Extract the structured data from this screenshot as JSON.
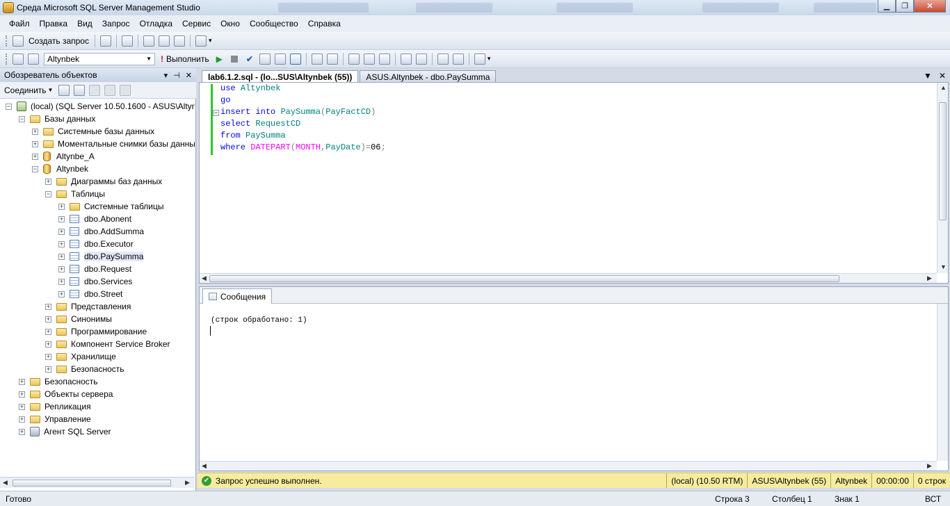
{
  "window": {
    "title": "Среда Microsoft SQL Server Management Studio",
    "min_label": "▁",
    "max_label": "❐",
    "close_label": "✕"
  },
  "menu": [
    "Файл",
    "Правка",
    "Вид",
    "Запрос",
    "Отладка",
    "Сервис",
    "Окно",
    "Сообщество",
    "Справка"
  ],
  "toolbar1": {
    "new_query_label": "Создать запрос"
  },
  "toolbar2": {
    "database_value": "Altynbek",
    "execute_label": "Выполнить"
  },
  "object_explorer": {
    "title": "Обозреватель объектов",
    "connect_label": "Соединить",
    "tree": {
      "server": "(local) (SQL Server 10.50.1600 - ASUS\\Altynb",
      "databases": "Базы данных",
      "system_databases": "Системные базы данных",
      "snapshots": "Моментальные снимки базы данны",
      "db_altynbe_a": "Altynbe_A",
      "db_altynbek": "Altynbek",
      "diagrams": "Диаграммы баз данных",
      "tables": "Таблицы",
      "system_tables": "Системные таблицы",
      "table_items": [
        "dbo.Abonent",
        "dbo.AddSumma",
        "dbo.Executor",
        "dbo.PaySumma",
        "dbo.Request",
        "dbo.Services",
        "dbo.Street"
      ],
      "views": "Представления",
      "synonyms": "Синонимы",
      "programmability": "Программирование",
      "service_broker": "Компонент Service Broker",
      "storage": "Хранилище",
      "db_security": "Безопасность",
      "security": "Безопасность",
      "server_objects": "Объекты сервера",
      "replication": "Репликация",
      "management": "Управление",
      "agent": "Агент SQL Server"
    }
  },
  "tabs": [
    {
      "label": "lab6.1.2.sql - (lo...SUS\\Altynbek (55))"
    },
    {
      "label": "ASUS.Altynbek - dbo.PaySumma"
    }
  ],
  "code": {
    "line1": {
      "kw": "use",
      "obj": "Altynbek"
    },
    "line2": {
      "kw": "go"
    },
    "line3": {
      "kw1": "insert",
      "kw2": "into",
      "obj": "PaySumma",
      "open": "(",
      "col": "PayFactCD",
      "close": ")"
    },
    "line4": {
      "kw": "select",
      "obj": "RequestCD"
    },
    "line5": {
      "kw": "from",
      "obj": "PaySumma"
    },
    "line6": {
      "kw": "where",
      "fn1": "DATEPART",
      "open": "(",
      "fn2": "MONTH",
      "comma": ",",
      "obj": "PayDate",
      "close": ")",
      "eq": "=",
      "val": "06",
      "semi": ";"
    }
  },
  "results": {
    "tab_label": "Сообщения",
    "message": "(строк обработано: 1)"
  },
  "query_status": {
    "message": "Запрос успешно выполнен.",
    "server": "(local) (10.50 RTM)",
    "login": "ASUS\\Altynbek (55)",
    "database": "Altynbek",
    "elapsed": "00:00:00",
    "rows": "0 строк"
  },
  "status_bar": {
    "ready": "Готово",
    "row": "Строка 3",
    "col": "Столбец 1",
    "char": "Знак 1",
    "mode": "ВСТ"
  }
}
